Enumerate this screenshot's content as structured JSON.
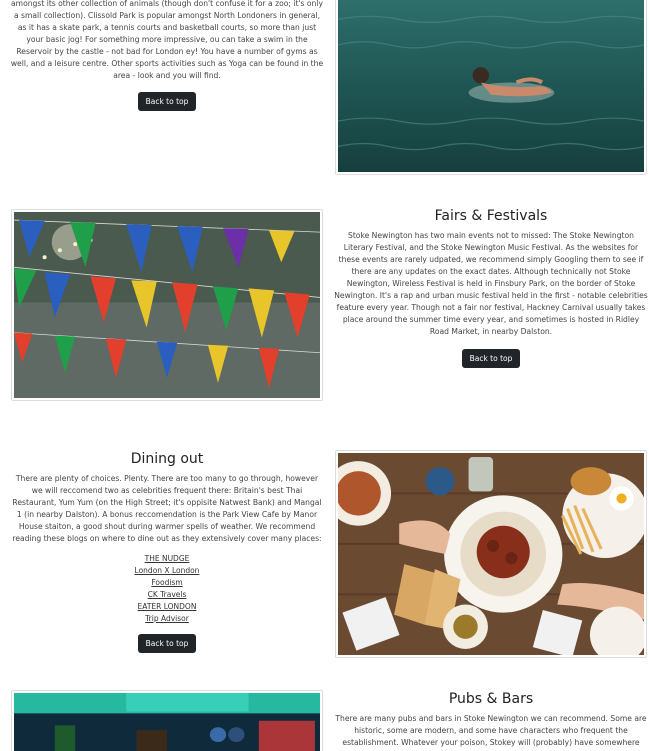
{
  "parks": {
    "text": "amongst its other collection of animals (though don't confuse it for a zoo; it's only a small collection). Clissold Park is popular amongst North Londoners in general, as it has a skate park, a tennis courts and basketball courts, so more than just your basic jog! For something more impressive, ou can take a swim in the Reservoir by the castle - not bad for London ey! You have a number of gyms as well, and a leisure centre. Other sports activities such as Yoga can be found in the area - look and you will find.",
    "button": "Back to top"
  },
  "fairs": {
    "heading": "Fairs & Festivals",
    "text": "Stoke Newington has two main events not to missed: The Stoke Newington Literary Festival, and the Stoke Newington Music Festival. As the websites for these events are rarely udpated, we recommend simply Googling them to see if there are any updates on the exact dates. Although technically not Stoke Newington, Wireless Festival is held in Finsbury Park, on the border of Stoke Newington. It's a rap and urban music festival held in the first - notable celebrities feature every year. Though not a fair nor festival, Hackney Carnival usually takes place around the summer time every year, and sometimes is hosted in Ridley Road Market, in nearby Dalston.",
    "button": "Back to top"
  },
  "dining": {
    "heading": "Dining out",
    "text": "There are plenty of choices. Plenty. There are too many to go through, however we will reccomend two as celebrities frequent there: Britain's best Thai Restaurant, Yum Yum (on the High Street; it's oppisite Natwest Bank) and Mangal 1 (in nearby Dalston). A bonus reccomendation is the Park View Cafe by Manor House staiton, a good shout during warmer spells of weather. We recommend reading these blogs on where to dine out as they extensively cover many places:",
    "links": [
      "THE NUDGE",
      "London X London",
      "Foodism",
      "CK Travels",
      "EATER LONDON",
      "Trip Advisor"
    ],
    "button": "Back to top"
  },
  "pubs": {
    "heading": "Pubs & Bars",
    "text": "There are many pubs and bars in Stoke Newington we can recommend. Some are historic, some are modern, and some have characters who frequent the establishment. Whatever your poison, Stokey will (probably) have somewhere that serves it. Here are a"
  }
}
